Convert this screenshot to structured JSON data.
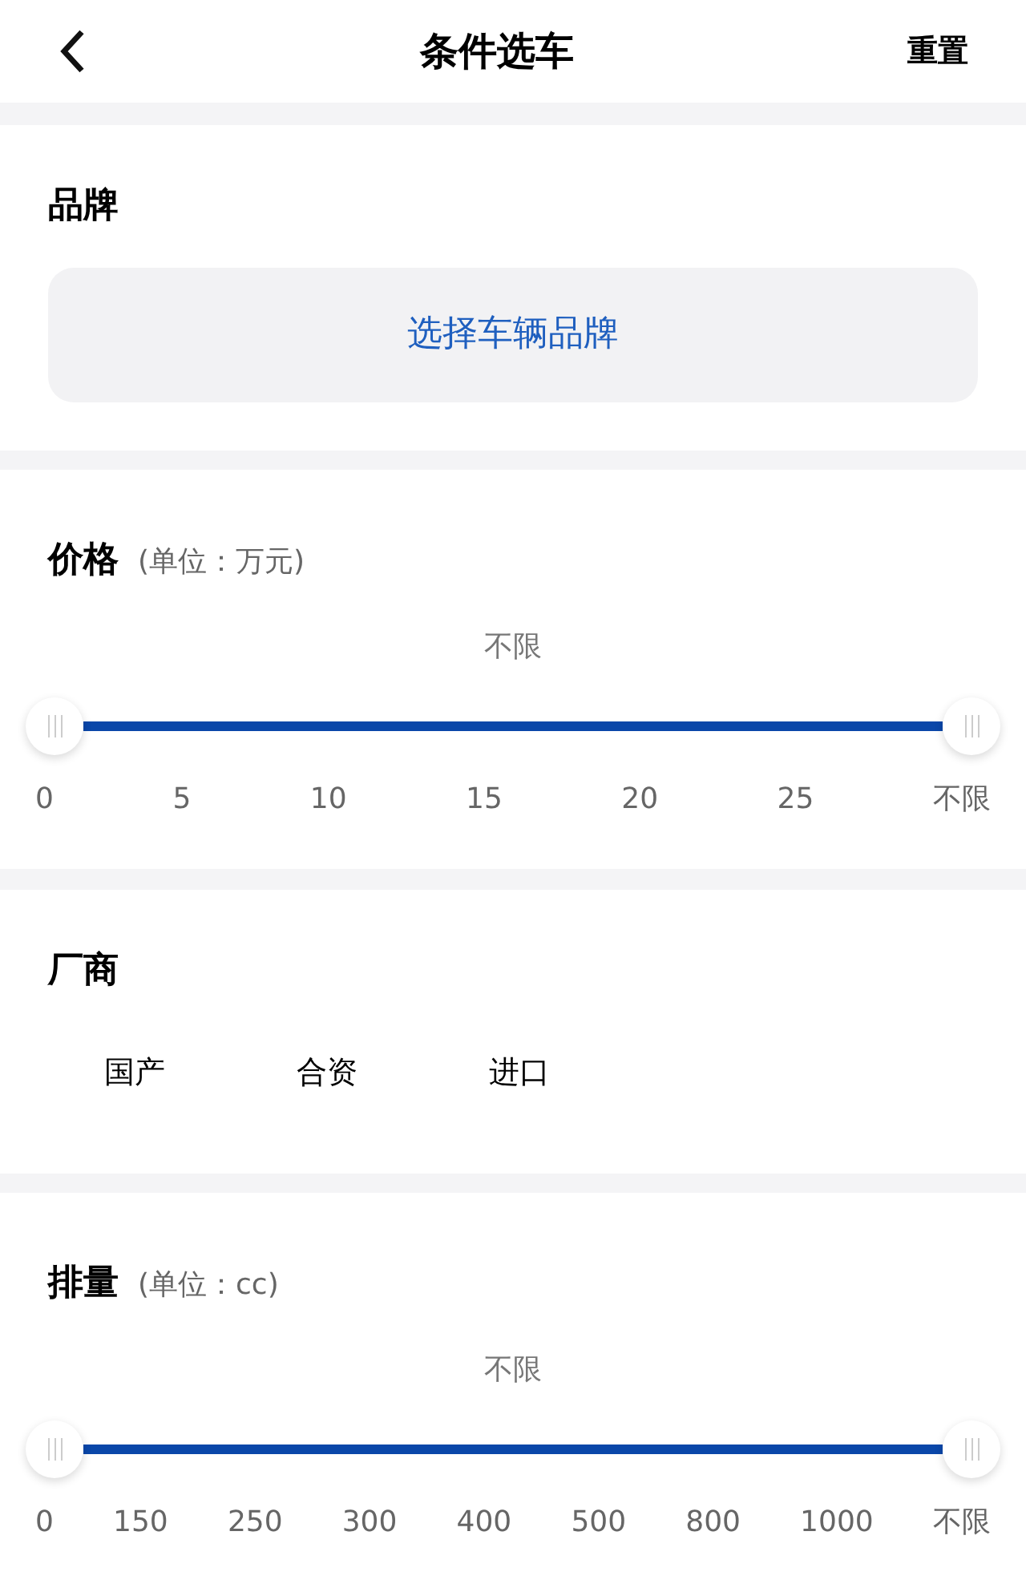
{
  "header": {
    "title": "条件选车",
    "reset": "重置"
  },
  "brand": {
    "title": "品牌",
    "button": "选择车辆品牌"
  },
  "price": {
    "title": "价格",
    "unit": "(单位：万元)",
    "reading": "不限",
    "level": 1,
    "ticks": [
      "0",
      "5",
      "10",
      "15",
      "20",
      "25",
      "不限"
    ]
  },
  "maker": {
    "title": "厂商",
    "options": [
      {
        "label": "国产",
        "selected": false
      },
      {
        "label": "合资",
        "selected": false
      },
      {
        "label": "进口",
        "selected": false
      }
    ]
  },
  "displacement": {
    "title": "排量",
    "unit": "(单位：cc)",
    "reading": "不限",
    "level": 1,
    "ticks": [
      "0",
      "150",
      "250",
      "300",
      "400",
      "500",
      "800",
      "1000",
      "不限"
    ]
  }
}
